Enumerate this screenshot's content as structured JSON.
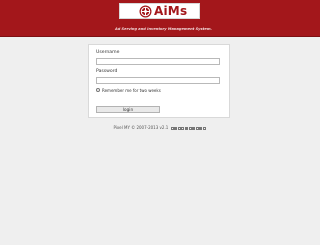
{
  "header": {
    "logo_text": "AiMs",
    "tagline": "Ad Serving and Inventory Management System.",
    "brand_color": "#a3171b"
  },
  "login": {
    "username_label": "Username",
    "username_value": "",
    "password_label": "Password",
    "password_value": "",
    "remember_label": "Remember me for two weeks",
    "remember_checked": false,
    "submit_label": "login"
  },
  "footer": {
    "copyright": "Pixel MY © 2007-2013 v2.1"
  }
}
